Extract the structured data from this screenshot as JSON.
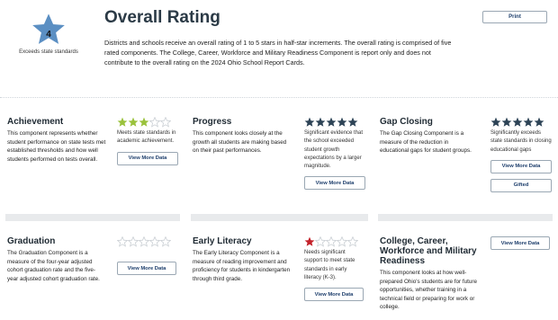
{
  "header": {
    "rating_value": "4",
    "rating_label": "Exceeds state standards",
    "title": "Overall Rating",
    "description": "Districts and schools receive an overall rating of 1 to 5 stars in half-star increments. The overall rating is comprised of five rated components. The College, Career, Workforce and Military Readiness Component is report only and does not contribute to the overall rating on the 2024 Ohio School Report Cards.",
    "print_label": "Print",
    "star_color": "#5b8fc3"
  },
  "colors": {
    "green": "#9ac23c",
    "navy": "#2d4356",
    "red": "#c3222a",
    "empty": "#c9ced3"
  },
  "components": [
    {
      "key": "achievement",
      "title": "Achievement",
      "description": "This component represents whether student performance on state tests met established thresholds and how well students performed on tests overall.",
      "stars": 3,
      "star_color": "green",
      "rating_text": "Meets state standards in academic achievement.",
      "buttons": [
        "View More Data"
      ]
    },
    {
      "key": "progress",
      "title": "Progress",
      "description": "This component looks closely at the growth all students are making based on their past performances.",
      "stars": 5,
      "star_color": "navy",
      "rating_text": "Significant evidence that the school exceeded student growth expectations by a larger magnitude.",
      "buttons": [
        "View More Data"
      ]
    },
    {
      "key": "gap-closing",
      "title": "Gap Closing",
      "description": "The Gap Closing Component is a measure of the reduction in educational gaps for student groups.",
      "stars": 5,
      "star_color": "navy",
      "rating_text": "Significantly exceeds state standards in closing educational gaps",
      "buttons": [
        "View More Data",
        "Gifted"
      ]
    },
    {
      "key": "graduation",
      "title": "Graduation",
      "description": "The Graduation Component is a measure of the four-year adjusted cohort graduation rate and the five-year adjusted cohort graduation rate.",
      "stars": 0,
      "star_color": "empty",
      "rating_text": "",
      "buttons": [
        "View More Data"
      ]
    },
    {
      "key": "early-literacy",
      "title": "Early Literacy",
      "description": "The Early Literacy Component is a measure of reading improvement and proficiency for students in kindergarten through third grade.",
      "stars": 1,
      "star_color": "red",
      "rating_text": "Needs significant support to meet state standards in early literacy (K-3).",
      "buttons": [
        "View More Data"
      ]
    },
    {
      "key": "college-career",
      "title": "College, Career, Workforce and Military Readiness",
      "description": "This component looks at how well-prepared Ohio's students are for future opportunities, whether training in a technical field or preparing for work or college.",
      "stars": null,
      "star_color": "",
      "rating_text": "",
      "buttons": [
        "View More Data"
      ]
    }
  ]
}
